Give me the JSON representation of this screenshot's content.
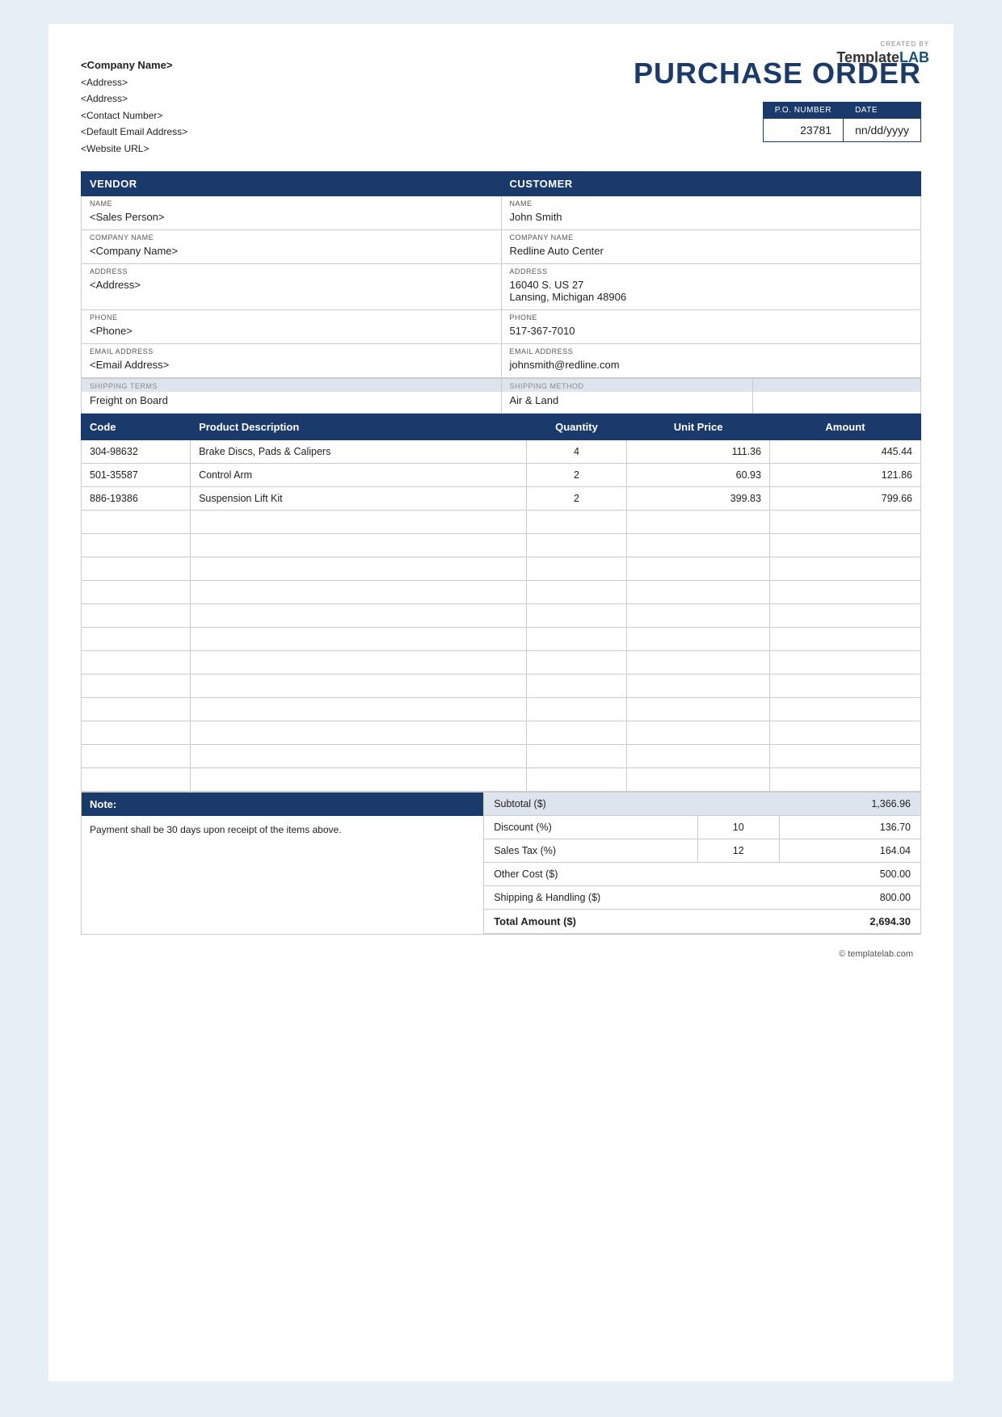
{
  "logo": {
    "created_by": "CREATED BY",
    "brand_template": "Template",
    "brand_lab": "LAB"
  },
  "company": {
    "name": "<Company Name>",
    "address1": "<Address>",
    "address2": "<Address>",
    "contact": "<Contact Number>",
    "email": "<Default Email Address>",
    "website": "<Website URL>"
  },
  "po": {
    "title": "PURCHASE ORDER",
    "number_label": "P.O. NUMBER",
    "date_label": "DATE",
    "number": "23781",
    "date": "nn/dd/yyyy"
  },
  "vendor": {
    "section_label": "VENDOR",
    "name_label": "NAME",
    "name_value": "<Sales Person>",
    "company_label": "COMPANY NAME",
    "company_value": "<Company Name>",
    "address_label": "ADDRESS",
    "address_value": "<Address>",
    "phone_label": "PHONE",
    "phone_value": "<Phone>",
    "email_label": "EMAIL ADDRESS",
    "email_value": "<Email Address>"
  },
  "customer": {
    "section_label": "CUSTOMER",
    "name_label": "NAME",
    "name_value": "John Smith",
    "company_label": "COMPANY NAME",
    "company_value": "Redline Auto Center",
    "address_label": "ADDRESS",
    "address_value": "16040 S. US 27\nLansing, Michigan 48906",
    "address_line1": "16040 S. US 27",
    "address_line2": "Lansing, Michigan 48906",
    "phone_label": "PHONE",
    "phone_value": "517-367-7010",
    "email_label": "EMAIL ADDRESS",
    "email_value": "johnsmith@redline.com"
  },
  "shipping": {
    "terms_label": "SHIPPING TERMS",
    "terms_value": "Freight on Board",
    "method_label": "SHIPPING METHOD",
    "method_value": "Air & Land"
  },
  "products": {
    "col_code": "Code",
    "col_desc": "Product Description",
    "col_qty": "Quantity",
    "col_unit": "Unit Price",
    "col_amount": "Amount",
    "items": [
      {
        "code": "304-98632",
        "desc": "Brake Discs, Pads & Calipers",
        "qty": "4",
        "unit_price": "111.36",
        "amount": "445.44"
      },
      {
        "code": "501-35587",
        "desc": "Control Arm",
        "qty": "2",
        "unit_price": "60.93",
        "amount": "121.86"
      },
      {
        "code": "886-19386",
        "desc": "Suspension Lift Kit",
        "qty": "2",
        "unit_price": "399.83",
        "amount": "799.66"
      }
    ],
    "empty_rows": 12
  },
  "note": {
    "header": "Note:",
    "body": "Payment shall be 30 days upon receipt of the items above."
  },
  "totals": {
    "subtotal_label": "Subtotal ($)",
    "subtotal_value": "1,366.96",
    "discount_label": "Discount (%)",
    "discount_pct": "10",
    "discount_value": "136.70",
    "tax_label": "Sales Tax (%)",
    "tax_pct": "12",
    "tax_value": "164.04",
    "other_label": "Other Cost ($)",
    "other_value": "500.00",
    "shipping_label": "Shipping & Handling ($)",
    "shipping_value": "800.00",
    "total_label": "Total Amount ($)",
    "total_value": "2,694.30"
  },
  "copyright": "© templatelab.com"
}
